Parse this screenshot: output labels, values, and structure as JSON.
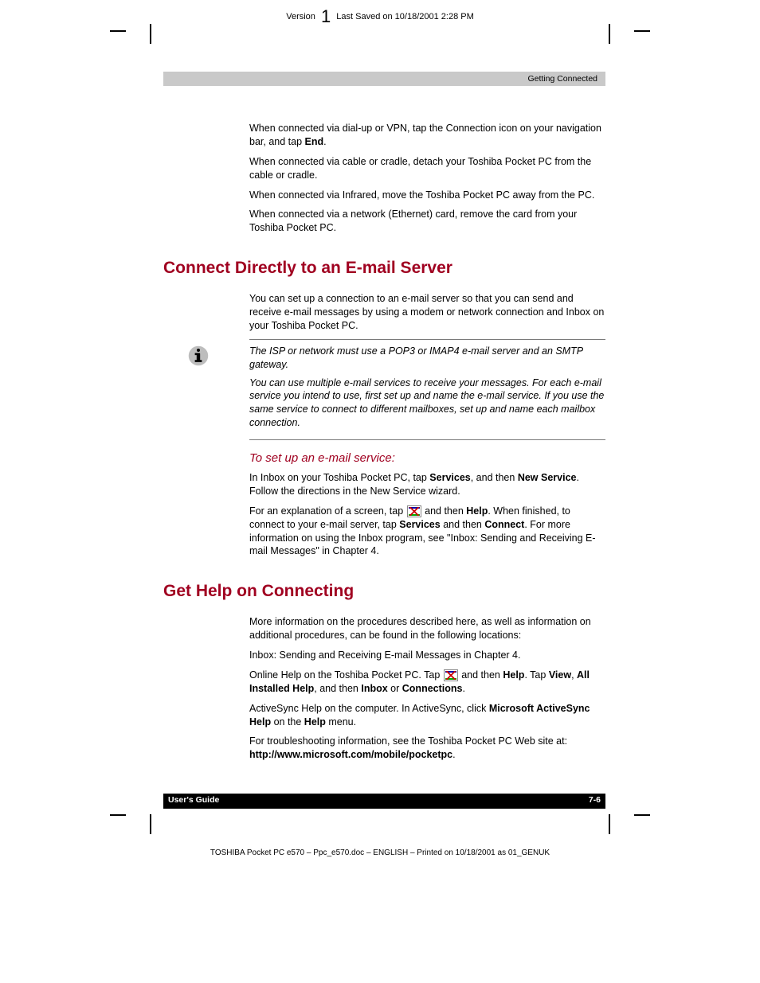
{
  "top": {
    "pre": "Version",
    "num": "1",
    "post": "Last Saved on 10/18/2001 2:28 PM"
  },
  "section_header": "Getting Connected",
  "intro_items": [
    {
      "t1": "When connected via dial-up or VPN, tap the Connection icon on your navigation bar, and tap ",
      "b1": "End",
      "t2": "."
    },
    {
      "t1": "When connected via cable or cradle, detach your Toshiba Pocket PC from the cable or cradle."
    },
    {
      "t1": "When connected via Infrared, move the Toshiba Pocket PC away from the PC."
    },
    {
      "t1": "When connected via a network (Ethernet) card, remove the card from your Toshiba Pocket PC."
    }
  ],
  "h_connect": "Connect Directly to an E-mail Server",
  "connect_p1": "You can set up a connection to an e-mail server so that you can send and receive e-mail messages by using a modem or network connection and Inbox on your Toshiba Pocket PC.",
  "note1": "The ISP or network must use a POP3 or IMAP4 e-mail server and an SMTP gateway.",
  "note2": "You can use multiple e-mail services to receive your messages. For each e-mail service you intend to use, first set up and name the e-mail service. If you use the same service to connect to different mailboxes, set up and name each mailbox connection.",
  "h_setup": "To set up an e-mail service:",
  "setup_item": {
    "t1": "In Inbox on your Toshiba Pocket PC, tap ",
    "b1": "Services",
    "t2": ", and then ",
    "b2": "New Service",
    "t3": ". Follow the directions in the New Service wizard."
  },
  "setup_p": {
    "t1": "For an explanation of a screen, tap ",
    "t2": " and then ",
    "b1": "Help",
    "t3": ". When finished, to connect to your e-mail server, tap ",
    "b2": "Services",
    "t4": " and then ",
    "b3": "Connect",
    "t5": ". For more information on using the Inbox program, see \"Inbox: Sending and Receiving E-mail Messages\" in Chapter 4."
  },
  "h_help": "Get Help on Connecting",
  "help_p1": "More information on the procedures described here, as well as information on additional procedures, can be found in the following locations:",
  "help_items": {
    "i1": "Inbox: Sending and Receiving E-mail Messages in Chapter 4.",
    "i2": {
      "t1": "Online Help on the Toshiba Pocket PC. Tap ",
      "t2": " and then ",
      "b1": "Help",
      "t3": ". Tap ",
      "b2": "View",
      "t4": ", ",
      "b3": "All Installed Help",
      "t5": ", and then ",
      "b4": "Inbox",
      "t6": " or ",
      "b5": "Connections",
      "t7": "."
    },
    "i3": {
      "t1": "ActiveSync Help on the computer. In ActiveSync, click ",
      "b1": "Microsoft ActiveSync Help",
      "t2": " on the ",
      "b2": "Help",
      "t3": " menu."
    },
    "i4": {
      "t1": "For troubleshooting information, see the Toshiba Pocket PC Web site at: ",
      "b1": "http://www.microsoft.com/mobile/pocketpc",
      "t2": "."
    }
  },
  "footer": {
    "left": "User's Guide",
    "right": "7-6"
  },
  "bottom": "TOSHIBA Pocket PC e570  – Ppc_e570.doc – ENGLISH – Printed on 10/18/2001 as 01_GENUK"
}
